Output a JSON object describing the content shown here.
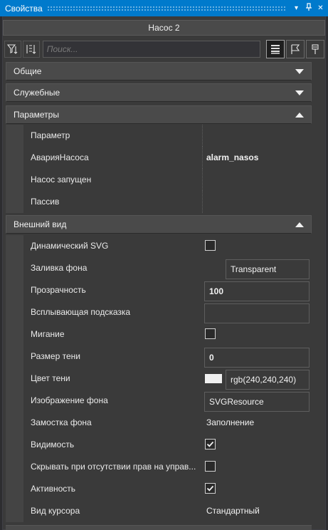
{
  "window": {
    "title": "Свойства",
    "pin_glyph": "▾",
    "pushpin_glyph": "⊥",
    "close_glyph": "✕"
  },
  "object_name": "Насос 2",
  "toolbar": {
    "search_placeholder": "Поиск...",
    "left_icons": [
      "filter-icon",
      "sort-icon"
    ],
    "right_icons": [
      "list-view-icon",
      "flag-icon",
      "pin-icon"
    ]
  },
  "categories": {
    "general": {
      "label": "Общие",
      "expanded": false
    },
    "service": {
      "label": "Служебные",
      "expanded": false
    },
    "params": {
      "label": "Параметры",
      "expanded": true
    },
    "appearance": {
      "label": "Внешний вид",
      "expanded": true
    }
  },
  "params_rows": [
    {
      "name": "Параметр",
      "value": ""
    },
    {
      "name": "АварияНасоса",
      "value": "alarm_nasos"
    },
    {
      "name": "Насос запущен",
      "value": ""
    },
    {
      "name": "Пассив",
      "value": ""
    }
  ],
  "appearance_rows": {
    "dynamic_svg": {
      "name": "Динамический SVG",
      "checked": false
    },
    "fill": {
      "name": "Заливка фона",
      "value": "Transparent"
    },
    "opacity": {
      "name": "Прозрачность",
      "value": "100"
    },
    "tooltip": {
      "name": "Всплывающая подсказка",
      "value": ""
    },
    "blink": {
      "name": "Мигание",
      "checked": false
    },
    "shadow_size": {
      "name": "Размер тени",
      "value": "0"
    },
    "shadow_color": {
      "name": "Цвет тени",
      "value": "rgb(240,240,240)",
      "swatch": "#f0f0f0"
    },
    "bg_image": {
      "name": "Изображение фона",
      "value": "SVGResource"
    },
    "bg_tiling": {
      "name": "Замостка фона",
      "value": "Заполнение"
    },
    "visibility": {
      "name": "Видимость",
      "checked": true
    },
    "hide_no_rights": {
      "name": "Скрывать при отсутствии прав на управ...",
      "checked": false
    },
    "active": {
      "name": "Активность",
      "checked": true
    },
    "cursor": {
      "name": "Вид курсора",
      "value": "Стандартный"
    }
  },
  "colors": {
    "accent": "#007acc",
    "background": "#3a3a3a",
    "category": "#4a4a4a"
  }
}
